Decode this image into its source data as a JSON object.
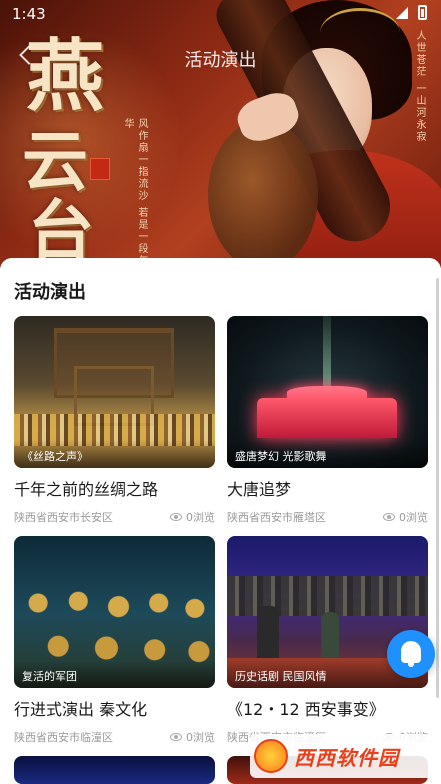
{
  "status_bar": {
    "time": "1:43"
  },
  "nav": {
    "title": "活动演出"
  },
  "hero": {
    "title_chars": [
      "燕",
      "云",
      "台"
    ],
    "poem_left": "风作扇一指流沙 若是一段年华",
    "poem_right": "人世苍茫 一山河永寂"
  },
  "section": {
    "title": "活动演出"
  },
  "cards": [
    {
      "image_tag": "《丝路之声》",
      "title": "千年之前的丝绸之路",
      "location": "陕西省西安市长安区",
      "views": "0浏览"
    },
    {
      "image_tag": "盛唐梦幻 光影歌舞",
      "title": "大唐追梦",
      "location": "陕西省西安市雁塔区",
      "views": "0浏览"
    },
    {
      "image_tag": "复活的军团",
      "title": "行进式演出 秦文化",
      "location": "陕西省西安市临潼区",
      "views": "0浏览"
    },
    {
      "image_tag": "历史话剧 民国风情",
      "title": "《12・12 西安事变》",
      "location": "陕西省西安市临潼区",
      "views": "0浏览"
    }
  ],
  "watermark": {
    "text": "西西软件园"
  },
  "colors": {
    "accent": "#1e90ff",
    "brand_red": "#e8401a"
  }
}
